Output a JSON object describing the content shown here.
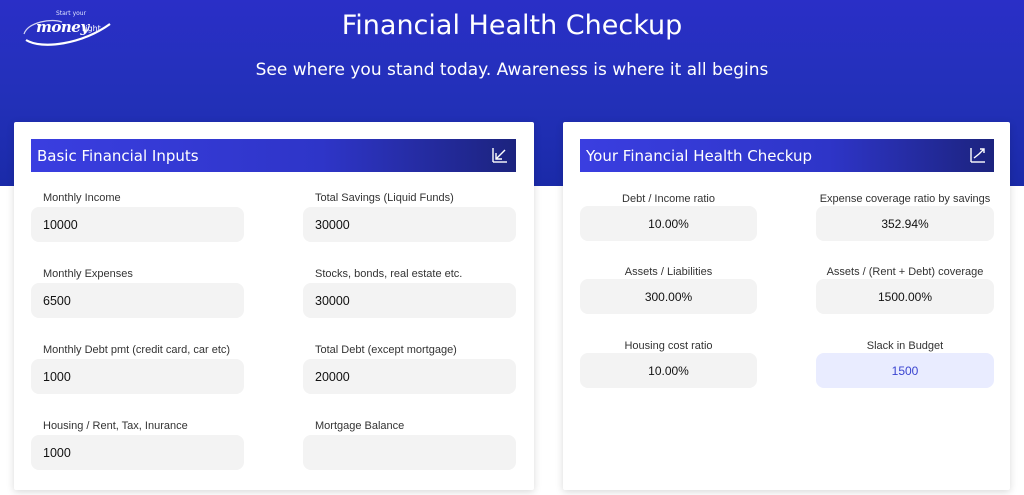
{
  "logo": {
    "brand": "money",
    "brand_suffix": "right",
    "tagline": "Start your"
  },
  "header": {
    "title": "Financial Health Checkup",
    "subtitle": "See where you stand today. Awareness is where it all begins"
  },
  "inputs": {
    "title": "Basic Financial Inputs",
    "icon": "arrow-down-left-icon",
    "fields": [
      {
        "label": "Monthly Income",
        "value": "10000"
      },
      {
        "label": "Total Savings (Liquid Funds)",
        "value": "30000"
      },
      {
        "label": "Monthly Expenses",
        "value": "6500"
      },
      {
        "label": "Stocks, bonds, real estate etc.",
        "value": "30000"
      },
      {
        "label": "Monthly Debt pmt (credit card, car etc)",
        "value": "1000"
      },
      {
        "label": "Total Debt (except mortgage)",
        "value": "20000"
      },
      {
        "label": "Housing / Rent, Tax, Inurance",
        "value": "1000"
      },
      {
        "label": "Mortgage Balance",
        "value": ""
      }
    ]
  },
  "results": {
    "title": "Your Financial Health Checkup",
    "icon": "trend-up-icon",
    "items": [
      {
        "label": "Debt / Income ratio",
        "value": "10.00%"
      },
      {
        "label": "Expense coverage ratio by savings",
        "value": "352.94%"
      },
      {
        "label": "Assets / Liabilities",
        "value": "300.00%"
      },
      {
        "label": "Assets / (Rent + Debt) coverage",
        "value": "1500.00%"
      },
      {
        "label": "Housing cost ratio",
        "value": "10.00%"
      },
      {
        "label": "Slack in Budget",
        "value": "1500"
      }
    ]
  },
  "colors": {
    "primary": "#2a2fc7",
    "accent": "#3a44d0",
    "field_bg": "#f3f3f3",
    "slack_bg": "#e9ecff"
  }
}
